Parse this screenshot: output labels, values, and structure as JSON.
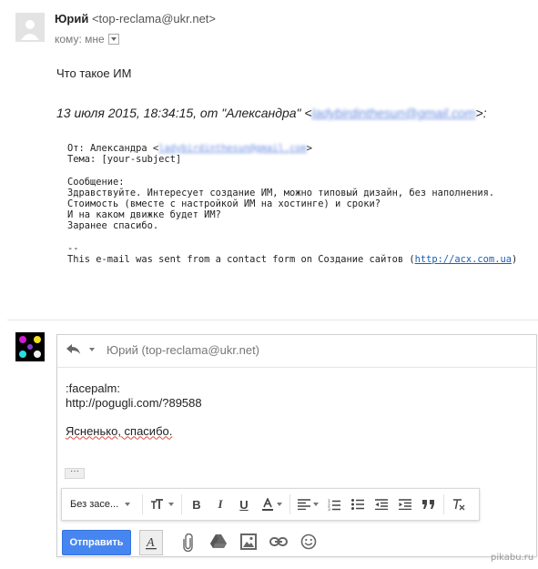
{
  "message": {
    "sender_name": "Юрий",
    "sender_email": "<top-reclama@ukr.net>",
    "to_label": "кому: мне",
    "subject_line": "Что такое ИМ",
    "quote_prefix": "13 июля 2015, 18:34:15, от \"Александра\" <",
    "quote_email_blurred": "ladybirdinthesun@gmail.com",
    "quote_suffix": ">:",
    "form": {
      "from_prefix": "От: Александра <",
      "from_email_blurred": "ladybirdinthesun@gmail.com",
      "from_suffix": ">",
      "topic": "Тема: [your-subject]",
      "blank1": "",
      "msg_label": "Сообщение:",
      "line1": "Здравствуйте. Интересует создание ИМ, можно типовый дизайн, без наполнения.",
      "line2": "Стоимость (вместе с настройкой ИМ на хостинге) и сроки?",
      "line3": "И на каком движке будет ИМ?",
      "line4": "Заранее спасибо.",
      "blank2": "",
      "sig_sep": "--",
      "footer_prefix": "This e-mail was sent from a contact form on Создание сайтов (",
      "footer_link": "http://acx.com.ua",
      "footer_suffix": ")"
    }
  },
  "reply": {
    "to_text": "Юрий (top-reclama@ukr.net)",
    "line1": ":facepalm:",
    "line2": "http://pogugli.com/?89588",
    "line3": "Ясненько, спасибо.",
    "more_label": "···",
    "font_select": "Без засе...",
    "send_label": "Отправить"
  },
  "watermark": "pikabu.ru",
  "colors": {
    "send_button": "#4786f0",
    "link": "#1a5fb4",
    "spell_underline": "#e04a3f"
  }
}
